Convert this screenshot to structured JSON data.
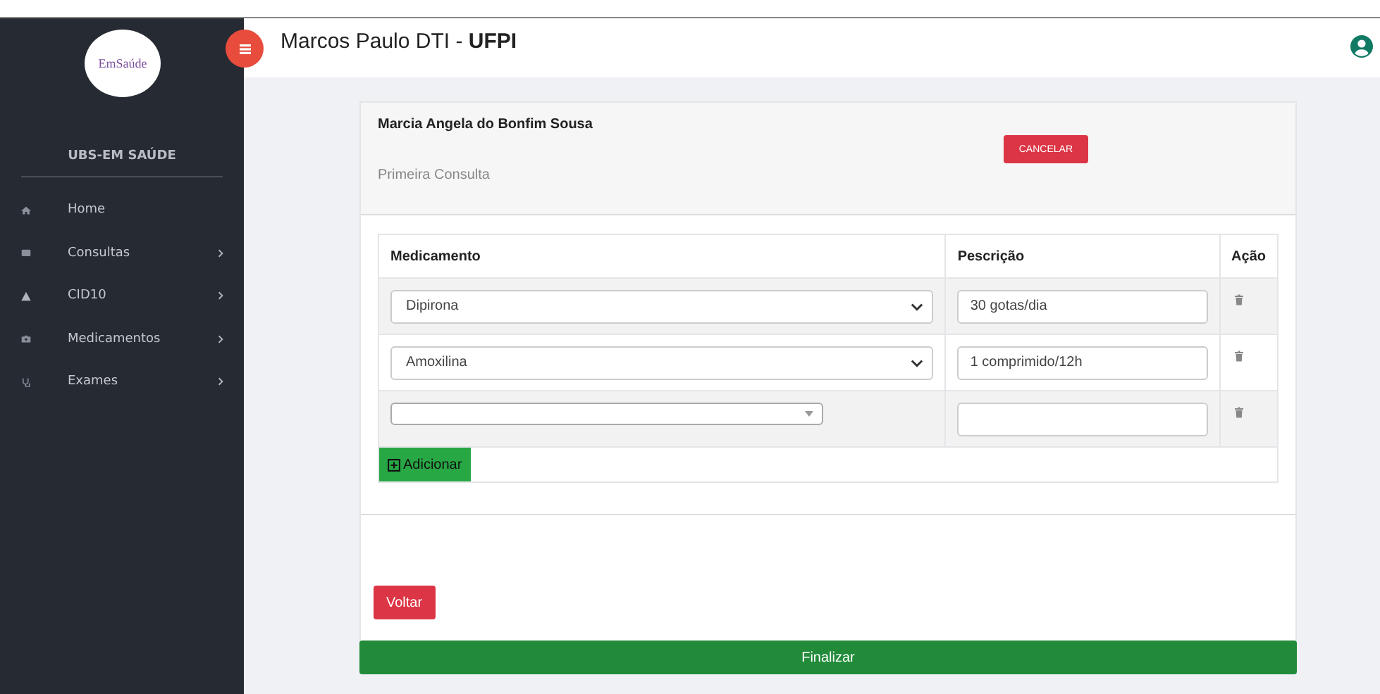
{
  "sidebar": {
    "logo_text": "EmSaúde",
    "title": "UBS-EM SAÚDE",
    "items": [
      {
        "label": "Home",
        "has_submenu": false
      },
      {
        "label": "Consultas",
        "has_submenu": true
      },
      {
        "label": "CID10",
        "has_submenu": true
      },
      {
        "label": "Medicamentos",
        "has_submenu": true
      },
      {
        "label": "Exames",
        "has_submenu": true
      }
    ]
  },
  "header": {
    "title": "Marcos Paulo DTI - **UFPI**"
  },
  "card": {
    "patient": "Marcia Angela do Bonfim Sousa",
    "subtitle": "Primeira Consulta",
    "cancel_button": "CANCELAR"
  },
  "table": {
    "columns": [
      "Medicamento",
      "Pescrição",
      "Ação"
    ],
    "rows": [
      {
        "medicamento": "Dipirona",
        "prescricao": "30 gotas/dia",
        "kind": "select"
      },
      {
        "medicamento": "Amoxilina",
        "prescricao": "1 comprimido/12h",
        "kind": "select"
      },
      {
        "kind": "combo"
      }
    ],
    "add_button": "Adicionar"
  },
  "back_button": "Voltar",
  "finish_button": "Finalizar"
}
